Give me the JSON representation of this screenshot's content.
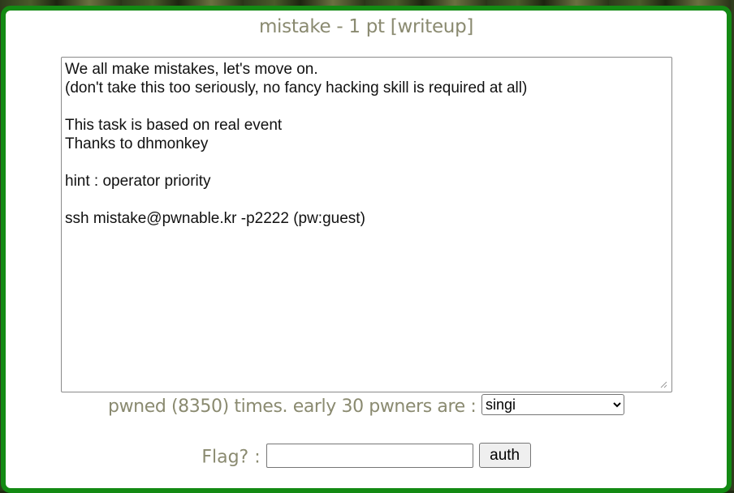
{
  "challenge": {
    "title": "mistake - 1 pt",
    "writeup_link": "[writeup]",
    "description": "We all make mistakes, let's move on.\n(don't take this too seriously, no fancy hacking skill is required at all)\n\nThis task is based on real event\nThanks to dhmonkey\n\nhint : operator priority\n\nssh mistake@pwnable.kr -p2222 (pw:guest)"
  },
  "pwned": {
    "text": "pwned (8350) times. early 30 pwners are :",
    "selected_pwner": "singi"
  },
  "flag": {
    "label": "Flag? :",
    "input_value": "",
    "submit_label": "auth"
  },
  "colors": {
    "frame_border": "#138a13",
    "label_text": "#8a8a70"
  }
}
